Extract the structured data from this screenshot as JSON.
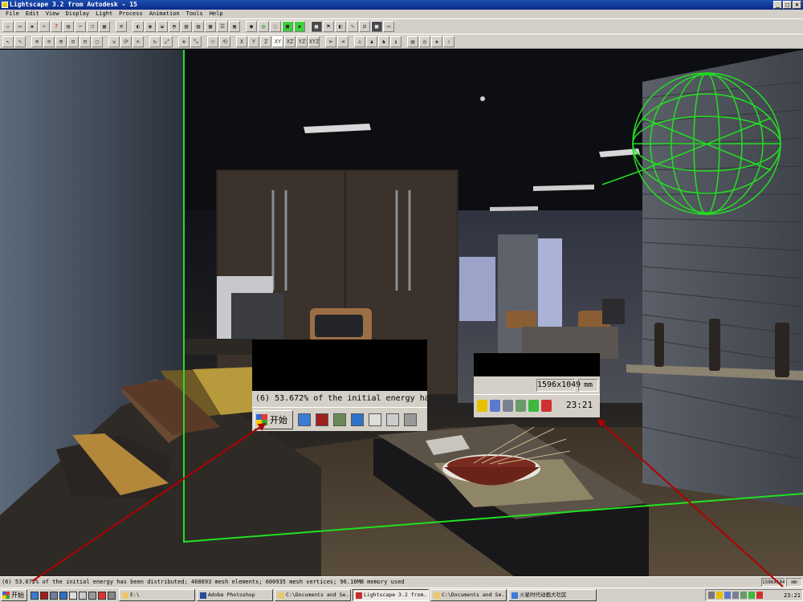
{
  "window": {
    "title": "Lightscape 3.2 from Autodesk - 15",
    "controls": [
      "_",
      "□",
      "×"
    ]
  },
  "menu": [
    "File",
    "Edit",
    "View",
    "Display",
    "Light",
    "Process",
    "Animation",
    "Tools",
    "Help"
  ],
  "toolbar_row1": {
    "groups": [
      [
        "new",
        "open",
        "save",
        "undo",
        "help",
        "print",
        "cut",
        "copy",
        "paste",
        "select",
        "render",
        "delete",
        "options"
      ],
      [
        "camera",
        "view",
        "pan",
        "zoom",
        "orbit",
        "walk",
        "rotate",
        "fly",
        "front",
        "grid",
        "shade",
        "material",
        "light",
        "solid",
        "green-cube"
      ],
      [
        "wire",
        "render1",
        "render2",
        "render3",
        "render4",
        "render5",
        "render6"
      ]
    ]
  },
  "toolbar_row2": {
    "axis_labels": [
      "X",
      "Y",
      "Z",
      "XY",
      "XZ",
      "YZ",
      "XYZ"
    ]
  },
  "zoom_start": {
    "status_text": "(6) 53.672% of the initial energy ha",
    "start_label": "开始"
  },
  "zoom_tray": {
    "dims": "1596x1049",
    "unit": "mm",
    "time": "23:21"
  },
  "statusbar": {
    "text": "(6) 53.672% of the initial energy has been distributed; 468693 mesh elements; 600935 mesh vertices; 96.16MB memory used",
    "dims": "1596x1049",
    "unit": "mm"
  },
  "taskbar": {
    "start_label": "开始",
    "tasks": [
      {
        "label": "E:\\",
        "active": false
      },
      {
        "label": "Adobe Photoshop",
        "active": false
      },
      {
        "label": "C:\\Documents and Se...",
        "active": false
      },
      {
        "label": "Lightscape 3.2 from...",
        "active": true
      },
      {
        "label": "C:\\Documents and Se...",
        "active": false
      },
      {
        "label": "火星时代动画大社区",
        "active": false
      }
    ],
    "clock": "23:21"
  },
  "colors": {
    "accent_wire": "#22e022",
    "arrow": "#b00000"
  }
}
